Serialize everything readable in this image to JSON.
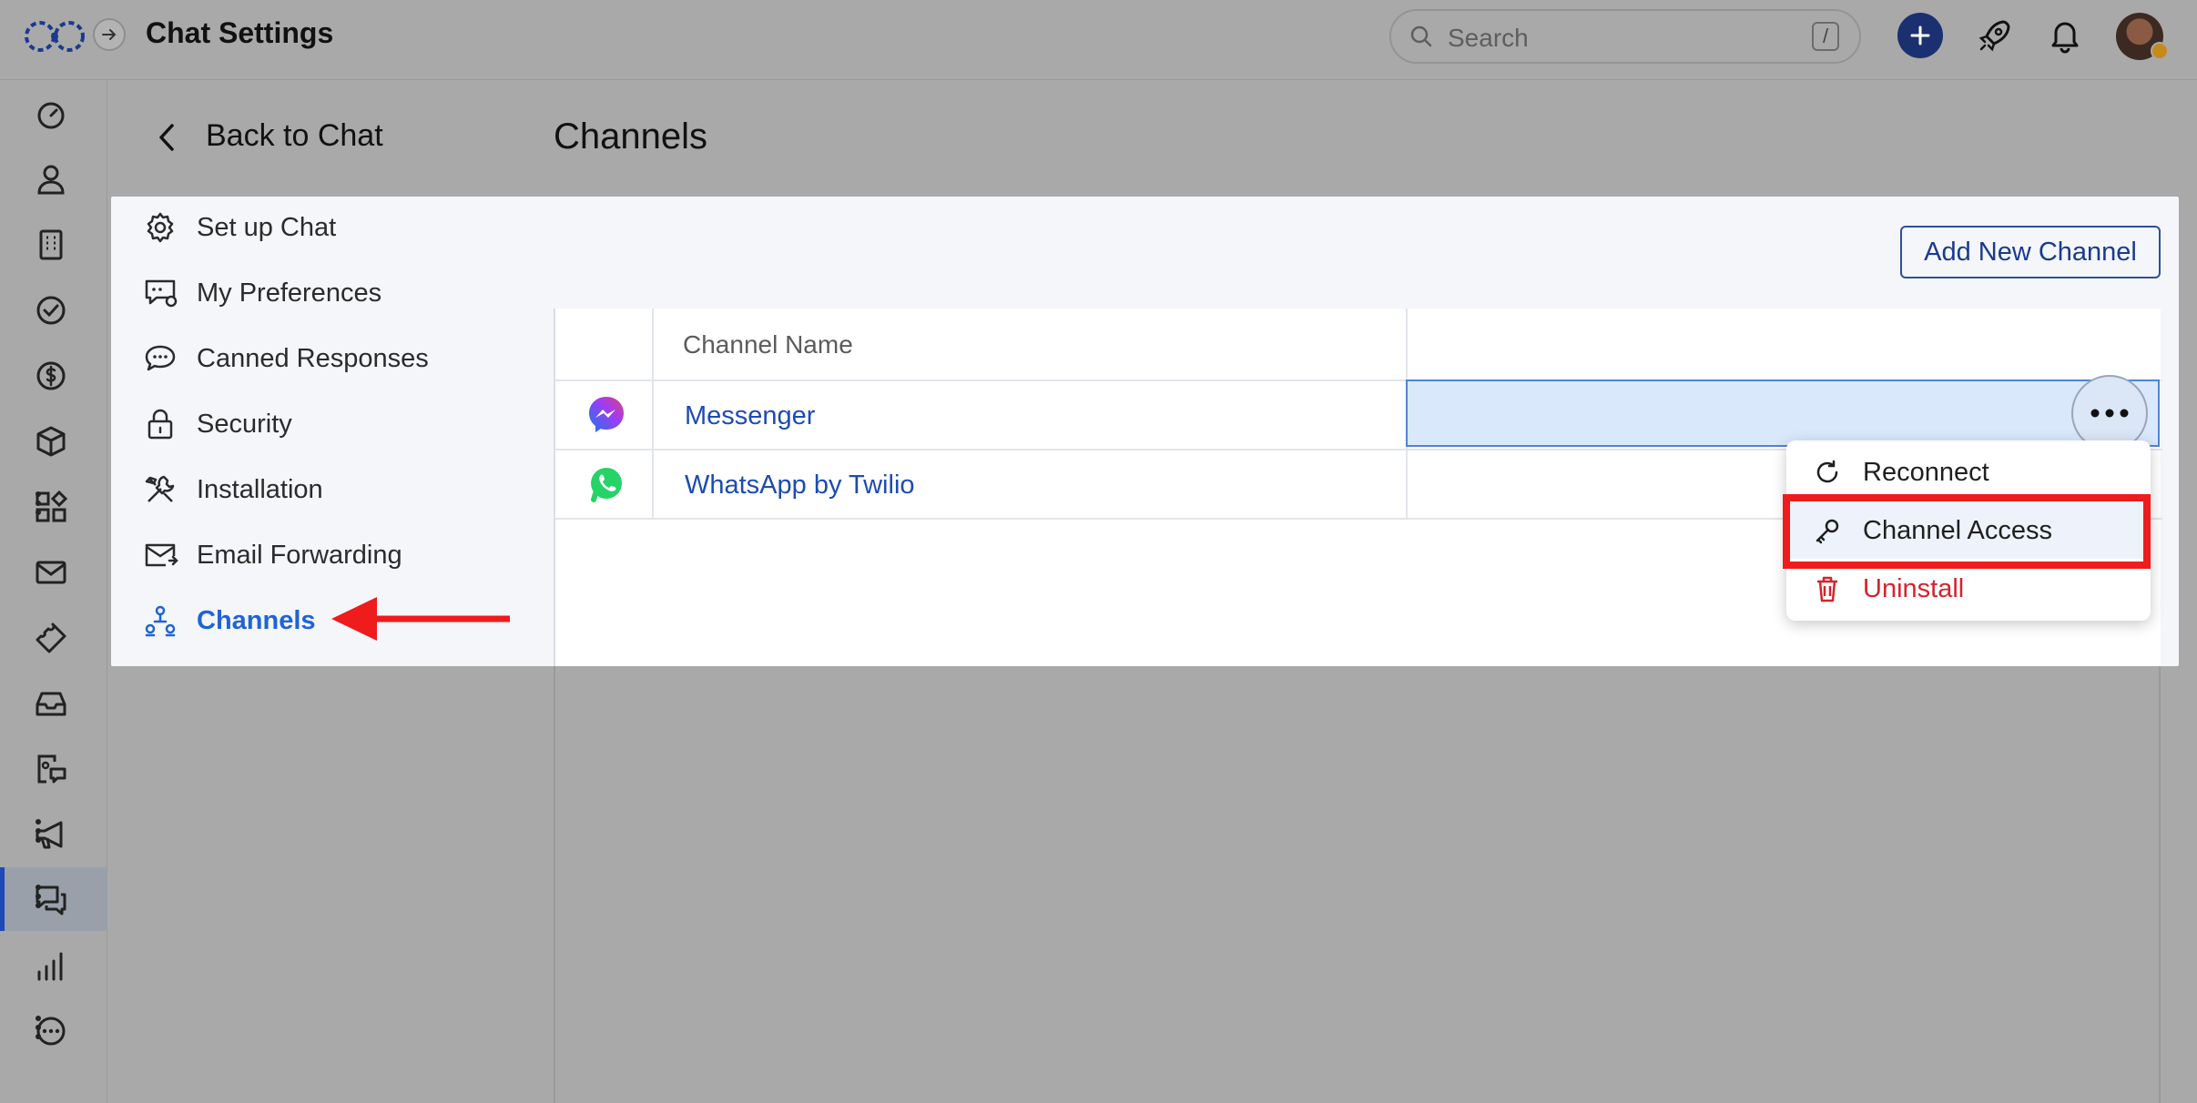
{
  "app": {
    "title": "Chat Settings"
  },
  "search": {
    "placeholder": "Search",
    "shortcut": "/"
  },
  "rail": {
    "items": [
      {
        "icon": "dashboard-icon"
      },
      {
        "icon": "person-icon"
      },
      {
        "icon": "building-icon"
      },
      {
        "icon": "check-circle-icon"
      },
      {
        "icon": "dollar-icon"
      },
      {
        "icon": "box-icon"
      },
      {
        "icon": "apps-icon"
      },
      {
        "icon": "mail-icon"
      },
      {
        "icon": "ticket-icon"
      },
      {
        "icon": "inbox-icon"
      },
      {
        "icon": "document-chat-icon"
      },
      {
        "icon": "megaphone-icon"
      },
      {
        "icon": "chat-icon"
      },
      {
        "icon": "bar-chart-icon"
      },
      {
        "icon": "more-circle-icon"
      }
    ],
    "active": "chat-icon"
  },
  "nav": {
    "back_label": "Back to Chat",
    "items": [
      {
        "label": "Set up Chat",
        "icon": "gear-icon"
      },
      {
        "label": "My Preferences",
        "icon": "preferences-icon"
      },
      {
        "label": "Canned Responses",
        "icon": "speech-bubble-icon"
      },
      {
        "label": "Security",
        "icon": "lock-icon"
      },
      {
        "label": "Installation",
        "icon": "tools-icon"
      },
      {
        "label": "Email Forwarding",
        "icon": "email-forward-icon"
      },
      {
        "label": "Channels",
        "icon": "channels-icon"
      }
    ],
    "active": "Channels"
  },
  "main": {
    "title": "Channels",
    "add_button": "Add New Channel",
    "table": {
      "header": {
        "name": "Channel Name"
      },
      "rows": [
        {
          "name": "Messenger",
          "icon": "messenger-icon"
        },
        {
          "name": "WhatsApp by Twilio",
          "icon": "whatsapp-icon"
        }
      ]
    }
  },
  "menu": {
    "items": [
      {
        "label": "Reconnect",
        "icon": "refresh-icon"
      },
      {
        "label": "Channel Access",
        "icon": "key-icon"
      },
      {
        "label": "Uninstall",
        "icon": "trash-icon"
      }
    ],
    "highlighted": "Channel Access"
  },
  "colors": {
    "accent": "#1f63d8",
    "annotation": "#ee1c1c",
    "danger": "#d4242c",
    "messenger_start": "#1877f2",
    "messenger_end": "#e0427f",
    "whatsapp": "#25d366"
  }
}
